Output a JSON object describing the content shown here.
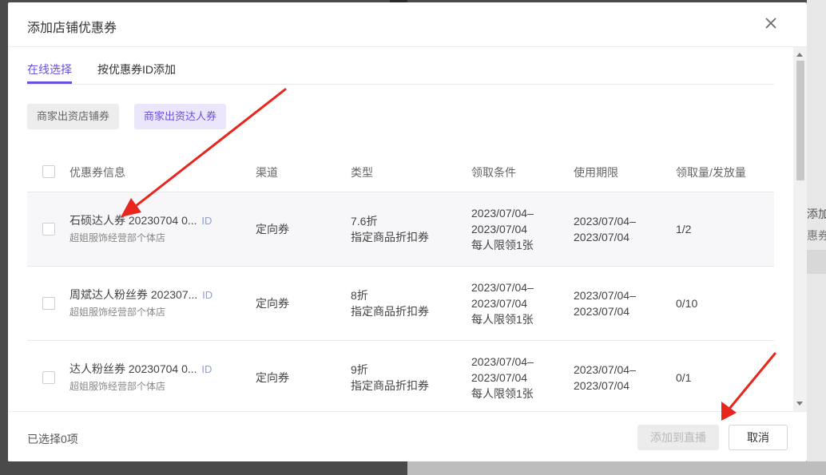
{
  "background": {
    "fragment_1": "添加",
    "fragment_2": "惠券"
  },
  "dialog": {
    "title": "添加店铺优惠券"
  },
  "tabs": [
    {
      "label": "在线选择",
      "active": true
    },
    {
      "label": "按优惠券ID添加",
      "active": false
    }
  ],
  "filters": [
    {
      "label": "商家出资店铺券",
      "active": false
    },
    {
      "label": "商家出资达人券",
      "active": true
    }
  ],
  "table": {
    "headers": [
      "优惠券信息",
      "渠道",
      "类型",
      "领取条件",
      "使用期限",
      "领取量/发放量"
    ],
    "rows": [
      {
        "name": "石硕达人券 20230704 0...",
        "id_tag": "ID",
        "shop": "超姐服饰经营部个体店",
        "channel": "定向券",
        "type_line1": "7.6折",
        "type_line2": "指定商品折扣券",
        "cond_line1": "2023/07/04–",
        "cond_line2": "2023/07/04",
        "cond_line3": "每人限领1张",
        "period_line1": "2023/07/04–",
        "period_line2": "2023/07/04",
        "quota": "1/2"
      },
      {
        "name": "周斌达人粉丝券 202307...",
        "id_tag": "ID",
        "shop": "超姐服饰经营部个体店",
        "channel": "定向券",
        "type_line1": "8折",
        "type_line2": "指定商品折扣券",
        "cond_line1": "2023/07/04–",
        "cond_line2": "2023/07/04",
        "cond_line3": "每人限领1张",
        "period_line1": "2023/07/04–",
        "period_line2": "2023/07/04",
        "quota": "0/10"
      },
      {
        "name": "达人粉丝券 20230704 0...",
        "id_tag": "ID",
        "shop": "超姐服饰经营部个体店",
        "channel": "定向券",
        "type_line1": "9折",
        "type_line2": "指定商品折扣券",
        "cond_line1": "2023/07/04–",
        "cond_line2": "2023/07/04",
        "cond_line3": "每人限领1张",
        "period_line1": "2023/07/04–",
        "period_line2": "2023/07/04",
        "quota": "0/1"
      }
    ]
  },
  "footer": {
    "selected_count": "已选择0项",
    "add_button": "添加到直播",
    "cancel_button": "取消"
  },
  "colors": {
    "accent": "#6b4fe0",
    "annotation_arrow": "#e8261e"
  }
}
